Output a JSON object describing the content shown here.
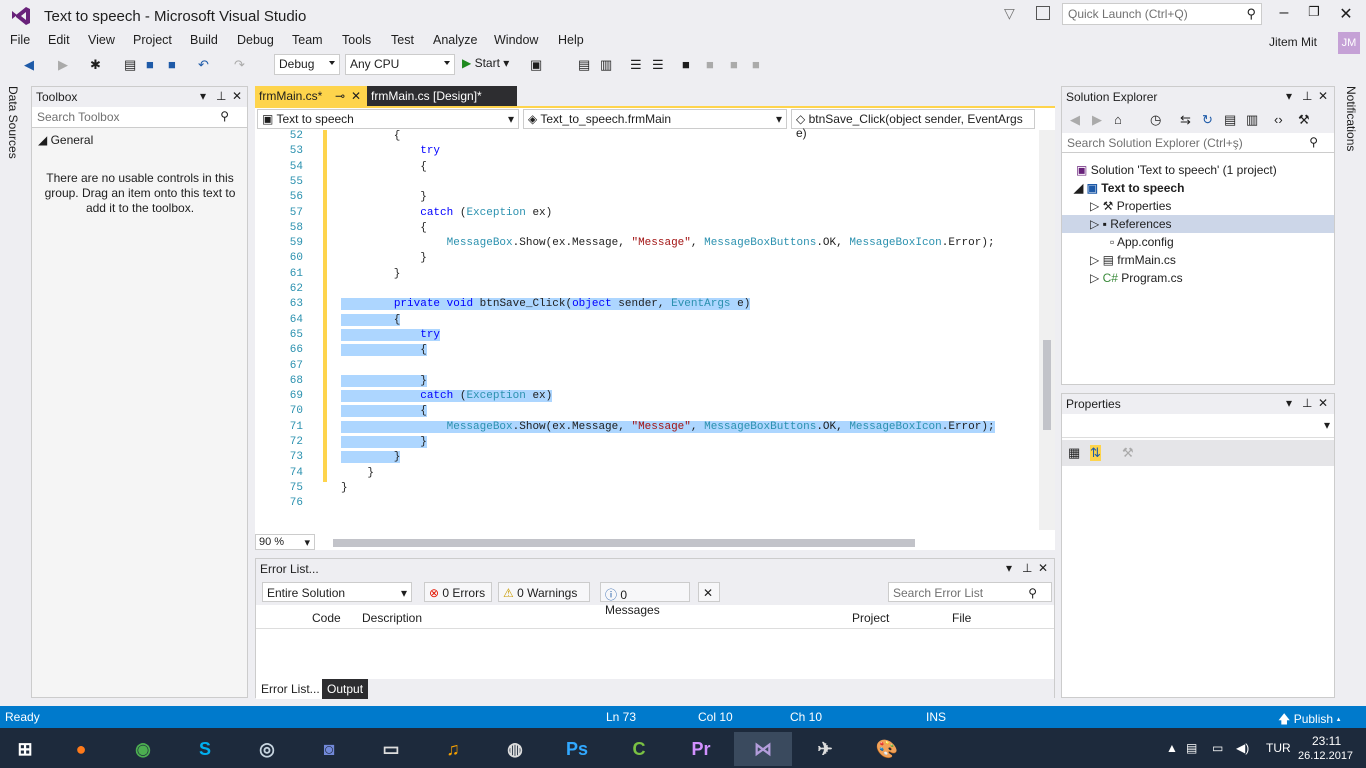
{
  "title": "Text to speech - Microsoft Visual Studio",
  "quick_launch": "Quick Launch (Ctrl+Q)",
  "menu": [
    "File",
    "Edit",
    "View",
    "Project",
    "Build",
    "Debug",
    "Team",
    "Tools",
    "Test",
    "Analyze",
    "Window",
    "Help"
  ],
  "user": {
    "name": "Jitem Mit",
    "initials": "JM"
  },
  "toolbar": {
    "config": "Debug",
    "platform": "Any CPU",
    "start": "Start"
  },
  "side_tab": "Data Sources",
  "toolbox": {
    "title": "Toolbox",
    "search": "Search Toolbox",
    "group": "General",
    "empty": "There are no usable controls in this group. Drag an item onto this text to add it to the toolbox."
  },
  "tabs": [
    {
      "label": "frmMain.cs*"
    },
    {
      "label": "frmMain.cs [Design]*"
    }
  ],
  "nav": {
    "project": "Text to speech",
    "class": "Text_to_speech.frmMain",
    "member": "btnSave_Click(object sender, EventArgs e)"
  },
  "code_lines": [
    {
      "n": "52",
      "t": "        {"
    },
    {
      "n": "53",
      "t": "            try"
    },
    {
      "n": "54",
      "t": "            {"
    },
    {
      "n": "55",
      "t": ""
    },
    {
      "n": "56",
      "t": "            }"
    },
    {
      "n": "57",
      "t": "            catch (Exception ex)"
    },
    {
      "n": "58",
      "t": "            {"
    },
    {
      "n": "59",
      "t": "                MessageBox.Show(ex.Message, \"Message\", MessageBoxButtons.OK, MessageBoxIcon.Error);"
    },
    {
      "n": "60",
      "t": "            }"
    },
    {
      "n": "61",
      "t": "        }"
    },
    {
      "n": "62",
      "t": ""
    },
    {
      "n": "63",
      "t": "        private void btnSave_Click(object sender, EventArgs e)"
    },
    {
      "n": "64",
      "t": "        {"
    },
    {
      "n": "65",
      "t": "            try"
    },
    {
      "n": "66",
      "t": "            {"
    },
    {
      "n": "67",
      "t": ""
    },
    {
      "n": "68",
      "t": "            }"
    },
    {
      "n": "69",
      "t": "            catch (Exception ex)"
    },
    {
      "n": "70",
      "t": "            {"
    },
    {
      "n": "71",
      "t": "                MessageBox.Show(ex.Message, \"Message\", MessageBoxButtons.OK, MessageBoxIcon.Error);"
    },
    {
      "n": "72",
      "t": "            }"
    },
    {
      "n": "73",
      "t": "        }"
    },
    {
      "n": "74",
      "t": "    }"
    },
    {
      "n": "75",
      "t": "}"
    },
    {
      "n": "76",
      "t": ""
    }
  ],
  "zoom": "90 %",
  "error_list": {
    "title": "Error List...",
    "scope": "Entire Solution",
    "errors": "0 Errors",
    "warnings": "0 Warnings",
    "messages": "0 Messages",
    "search": "Search Error List",
    "columns": [
      "Code",
      "Description",
      "Project",
      "File"
    ],
    "tabs": [
      "Error List...",
      "Output"
    ]
  },
  "solution_explorer": {
    "title": "Solution Explorer",
    "search": "Search Solution Explorer (Ctrl+ş)",
    "items": [
      {
        "label": "Solution 'Text to speech' (1 project)",
        "icon": "solution-icon"
      },
      {
        "label": "Text to speech",
        "icon": "csharp-project-icon"
      },
      {
        "label": "Properties",
        "icon": "wrench-icon"
      },
      {
        "label": "References",
        "icon": "references-icon"
      },
      {
        "label": "App.config",
        "icon": "config-icon"
      },
      {
        "label": "frmMain.cs",
        "icon": "form-icon"
      },
      {
        "label": "Program.cs",
        "icon": "csharp-file-icon"
      }
    ]
  },
  "properties": {
    "title": "Properties"
  },
  "notifications_tab": "Notifications",
  "status": {
    "ready": "Ready",
    "ln": "Ln 73",
    "col": "Col 10",
    "ch": "Ch 10",
    "ins": "INS",
    "publish": "Publish"
  },
  "taskbar": {
    "lang": "TUR",
    "time": "23:11",
    "date": "26.12.2017"
  },
  "colors": {
    "accent": "#007acc",
    "selection": "#add6ff",
    "keyword": "#0000ff",
    "type": "#2b91af",
    "string": "#a31515",
    "tab_active": "#fed44c"
  }
}
